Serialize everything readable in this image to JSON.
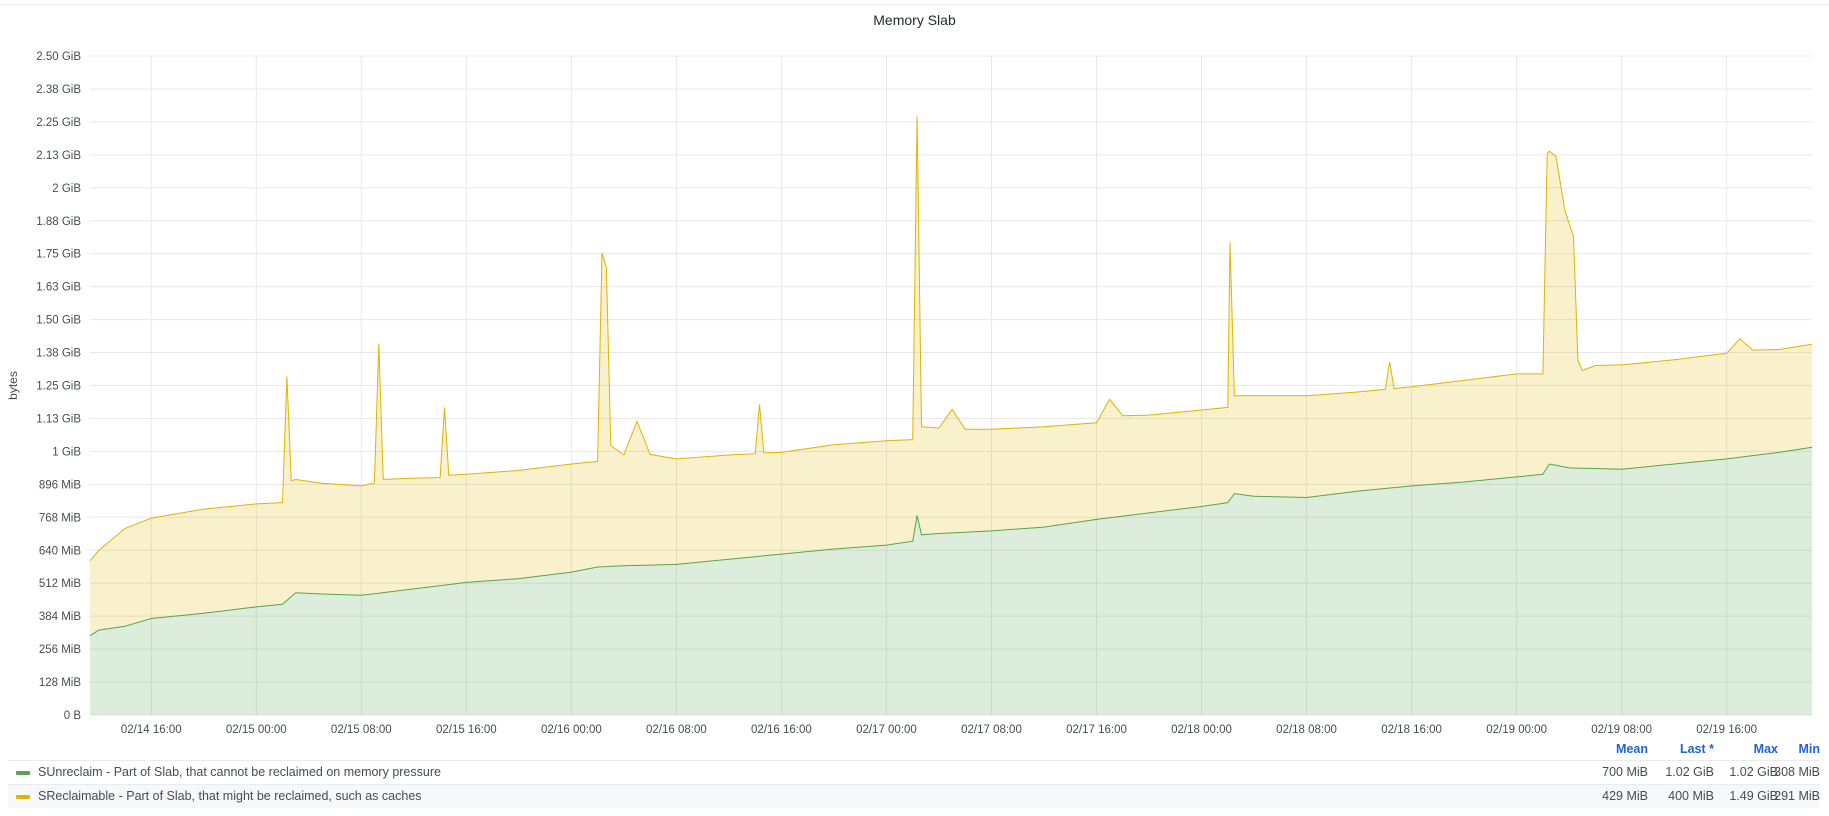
{
  "panel": {
    "title": "Memory Slab"
  },
  "legend": {
    "headers": {
      "mean": "Mean",
      "last": "Last *",
      "max": "Max",
      "min": "Min"
    },
    "rows": [
      {
        "name": "SUnreclaim - Part of Slab, that cannot be reclaimed on memory pressure",
        "color": "#56a64b",
        "mean": "700 MiB",
        "last": "1.02 GiB",
        "max": "1.02 GiB",
        "min": "308 MiB"
      },
      {
        "name": "SReclaimable - Part of Slab, that might be reclaimed, such as caches",
        "color": "#e0b400",
        "mean": "429 MiB",
        "last": "400 MiB",
        "max": "1.49 GiB",
        "min": "291 MiB"
      }
    ]
  },
  "chart_data": {
    "type": "area",
    "stacked": true,
    "title": "Memory Slab",
    "ylabel": "bytes",
    "y_unit": "MiB",
    "ylim": [
      0,
      2560
    ],
    "y_ticks": [
      {
        "value": 0,
        "label": "0 B"
      },
      {
        "value": 128,
        "label": "128 MiB"
      },
      {
        "value": 256,
        "label": "256 MiB"
      },
      {
        "value": 384,
        "label": "384 MiB"
      },
      {
        "value": 512,
        "label": "512 MiB"
      },
      {
        "value": 640,
        "label": "640 MiB"
      },
      {
        "value": 768,
        "label": "768 MiB"
      },
      {
        "value": 896,
        "label": "896 MiB"
      },
      {
        "value": 1024,
        "label": "1 GiB"
      },
      {
        "value": 1152,
        "label": "1.13 GiB"
      },
      {
        "value": 1280,
        "label": "1.25 GiB"
      },
      {
        "value": 1408,
        "label": "1.38 GiB"
      },
      {
        "value": 1536,
        "label": "1.50 GiB"
      },
      {
        "value": 1664,
        "label": "1.63 GiB"
      },
      {
        "value": 1792,
        "label": "1.75 GiB"
      },
      {
        "value": 1920,
        "label": "1.88 GiB"
      },
      {
        "value": 2048,
        "label": "2 GiB"
      },
      {
        "value": 2176,
        "label": "2.13 GiB"
      },
      {
        "value": 2304,
        "label": "2.25 GiB"
      },
      {
        "value": 2432,
        "label": "2.38 GiB"
      },
      {
        "value": 2560,
        "label": "2.50 GiB"
      }
    ],
    "x_unit": "hours",
    "xlim": [
      "02/14 11:20",
      "02/19 22:30"
    ],
    "x_ticks": [
      {
        "value": "02/14 16:00",
        "label": "02/14 16:00"
      },
      {
        "value": "02/15 00:00",
        "label": "02/15 00:00"
      },
      {
        "value": "02/15 08:00",
        "label": "02/15 08:00"
      },
      {
        "value": "02/15 16:00",
        "label": "02/15 16:00"
      },
      {
        "value": "02/16 00:00",
        "label": "02/16 00:00"
      },
      {
        "value": "02/16 08:00",
        "label": "02/16 08:00"
      },
      {
        "value": "02/16 16:00",
        "label": "02/16 16:00"
      },
      {
        "value": "02/17 00:00",
        "label": "02/17 00:00"
      },
      {
        "value": "02/17 08:00",
        "label": "02/17 08:00"
      },
      {
        "value": "02/17 16:00",
        "label": "02/17 16:00"
      },
      {
        "value": "02/18 00:00",
        "label": "02/18 00:00"
      },
      {
        "value": "02/18 08:00",
        "label": "02/18 08:00"
      },
      {
        "value": "02/18 16:00",
        "label": "02/18 16:00"
      },
      {
        "value": "02/19 00:00",
        "label": "02/19 00:00"
      },
      {
        "value": "02/19 08:00",
        "label": "02/19 08:00"
      },
      {
        "value": "02/19 16:00",
        "label": "02/19 16:00"
      }
    ],
    "grid": true,
    "legend_position": "bottom",
    "series": [
      {
        "name": "SUnreclaim - Part of Slab, that cannot be reclaimed on memory pressure",
        "color": "#56a64b",
        "points": [
          [
            "02/14 11:20",
            308
          ],
          [
            "02/14 12:00",
            330
          ],
          [
            "02/14 14:00",
            345
          ],
          [
            "02/14 16:00",
            375
          ],
          [
            "02/14 20:00",
            395
          ],
          [
            "02/15 00:00",
            420
          ],
          [
            "02/15 02:00",
            430
          ],
          [
            "02/15 03:00",
            475
          ],
          [
            "02/15 05:00",
            470
          ],
          [
            "02/15 08:00",
            465
          ],
          [
            "02/15 12:00",
            490
          ],
          [
            "02/15 16:00",
            515
          ],
          [
            "02/15 20:00",
            530
          ],
          [
            "02/16 00:00",
            555
          ],
          [
            "02/16 02:00",
            575
          ],
          [
            "02/16 04:00",
            580
          ],
          [
            "02/16 08:00",
            585
          ],
          [
            "02/16 12:00",
            605
          ],
          [
            "02/16 16:00",
            625
          ],
          [
            "02/16 20:00",
            645
          ],
          [
            "02/17 00:00",
            660
          ],
          [
            "02/17 02:00",
            675
          ],
          [
            "02/17 02:20",
            775
          ],
          [
            "02/17 02:40",
            700
          ],
          [
            "02/17 04:00",
            705
          ],
          [
            "02/17 08:00",
            715
          ],
          [
            "02/17 12:00",
            730
          ],
          [
            "02/17 16:00",
            760
          ],
          [
            "02/17 20:00",
            785
          ],
          [
            "02/18 00:00",
            810
          ],
          [
            "02/18 02:00",
            825
          ],
          [
            "02/18 02:30",
            860
          ],
          [
            "02/18 04:00",
            850
          ],
          [
            "02/18 08:00",
            845
          ],
          [
            "02/18 12:00",
            870
          ],
          [
            "02/18 16:00",
            890
          ],
          [
            "02/18 20:00",
            905
          ],
          [
            "02/19 00:00",
            925
          ],
          [
            "02/19 02:00",
            935
          ],
          [
            "02/19 02:30",
            975
          ],
          [
            "02/19 04:00",
            960
          ],
          [
            "02/19 08:00",
            955
          ],
          [
            "02/19 12:00",
            975
          ],
          [
            "02/19 16:00",
            995
          ],
          [
            "02/19 20:00",
            1020
          ],
          [
            "02/19 22:30",
            1040
          ]
        ]
      },
      {
        "name": "SReclaimable - Part of Slab, that might be reclaimed, such as caches",
        "color": "#e0b400",
        "points": [
          [
            "02/14 11:20",
            291
          ],
          [
            "02/14 12:00",
            310
          ],
          [
            "02/14 14:00",
            380
          ],
          [
            "02/14 16:00",
            390
          ],
          [
            "02/14 20:00",
            405
          ],
          [
            "02/15 00:00",
            400
          ],
          [
            "02/15 02:00",
            395
          ],
          [
            "02/15 02:20",
            870
          ],
          [
            "02/15 02:40",
            450
          ],
          [
            "02/15 03:00",
            440
          ],
          [
            "02/15 05:00",
            430
          ],
          [
            "02/15 08:00",
            425
          ],
          [
            "02/15 09:00",
            430
          ],
          [
            "02/15 09:20",
            970
          ],
          [
            "02/15 09:40",
            440
          ],
          [
            "02/15 12:00",
            430
          ],
          [
            "02/15 14:00",
            420
          ],
          [
            "02/15 14:20",
            690
          ],
          [
            "02/15 14:40",
            425
          ],
          [
            "02/15 16:00",
            420
          ],
          [
            "02/15 20:00",
            420
          ],
          [
            "02/16 00:00",
            420
          ],
          [
            "02/16 02:00",
            410
          ],
          [
            "02/16 02:20",
            1220
          ],
          [
            "02/16 02:40",
            1160
          ],
          [
            "02/16 03:00",
            470
          ],
          [
            "02/16 04:00",
            430
          ],
          [
            "02/16 05:00",
            560
          ],
          [
            "02/16 06:00",
            430
          ],
          [
            "02/16 08:00",
            410
          ],
          [
            "02/16 12:00",
            405
          ],
          [
            "02/16 14:00",
            400
          ],
          [
            "02/16 14:20",
            590
          ],
          [
            "02/16 14:40",
            400
          ],
          [
            "02/16 16:00",
            395
          ],
          [
            "02/16 20:00",
            405
          ],
          [
            "02/17 00:00",
            405
          ],
          [
            "02/17 02:00",
            395
          ],
          [
            "02/17 02:20",
            1550
          ],
          [
            "02/17 02:40",
            420
          ],
          [
            "02/17 04:00",
            410
          ],
          [
            "02/17 05:00",
            480
          ],
          [
            "02/17 06:00",
            400
          ],
          [
            "02/17 08:00",
            395
          ],
          [
            "02/17 12:00",
            390
          ],
          [
            "02/17 16:00",
            375
          ],
          [
            "02/17 17:00",
            460
          ],
          [
            "02/17 18:00",
            390
          ],
          [
            "02/17 20:00",
            380
          ],
          [
            "02/18 00:00",
            375
          ],
          [
            "02/18 02:00",
            370
          ],
          [
            "02/18 02:10",
            1000
          ],
          [
            "02/18 02:30",
            380
          ],
          [
            "02/18 04:00",
            390
          ],
          [
            "02/18 08:00",
            395
          ],
          [
            "02/18 12:00",
            385
          ],
          [
            "02/18 14:00",
            385
          ],
          [
            "02/18 14:20",
            490
          ],
          [
            "02/18 14:40",
            385
          ],
          [
            "02/18 16:00",
            385
          ],
          [
            "02/18 20:00",
            395
          ],
          [
            "02/19 00:00",
            400
          ],
          [
            "02/19 02:00",
            390
          ],
          [
            "02/19 02:20",
            1220
          ],
          [
            "02/19 03:00",
            1200
          ],
          [
            "02/19 03:40",
            1000
          ],
          [
            "02/19 04:20",
            900
          ],
          [
            "02/19 04:40",
            420
          ],
          [
            "02/19 05:00",
            380
          ],
          [
            "02/19 06:00",
            400
          ],
          [
            "02/19 08:00",
            405
          ],
          [
            "02/19 12:00",
            405
          ],
          [
            "02/19 16:00",
            410
          ],
          [
            "02/19 17:00",
            460
          ],
          [
            "02/19 18:00",
            410
          ],
          [
            "02/19 20:00",
            400
          ],
          [
            "02/19 22:30",
            400
          ]
        ]
      }
    ]
  }
}
